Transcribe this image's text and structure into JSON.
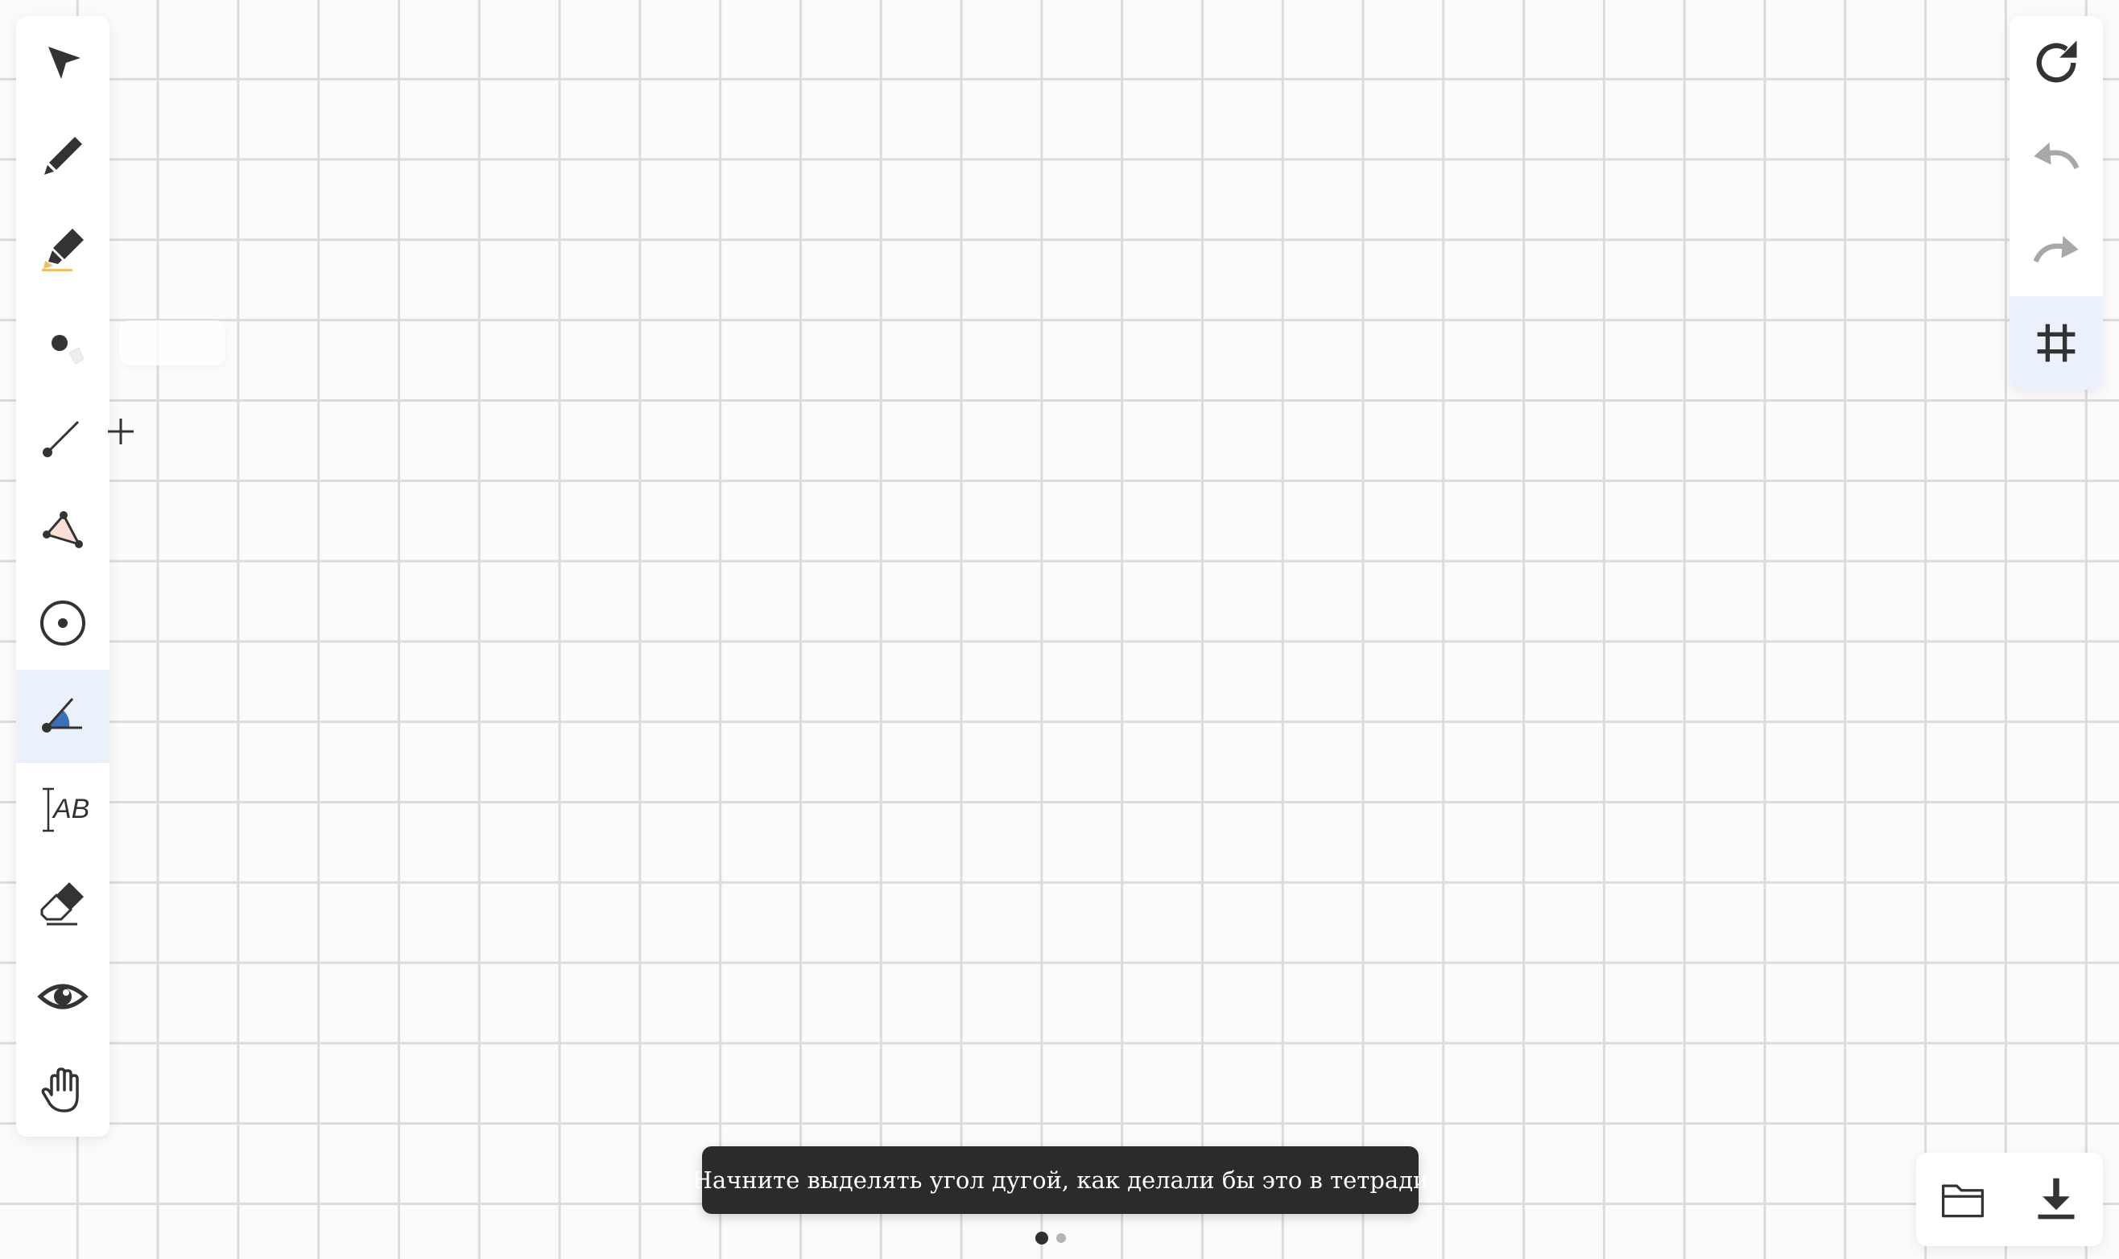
{
  "left_toolbar": {
    "tools": [
      {
        "name": "select",
        "icon": "arrow-pointer-icon"
      },
      {
        "name": "pen",
        "icon": "pencil-icon"
      },
      {
        "name": "highlighter",
        "icon": "highlighter-icon"
      },
      {
        "name": "point",
        "icon": "point-icon"
      },
      {
        "name": "segment",
        "icon": "segment-icon"
      },
      {
        "name": "polygon",
        "icon": "polygon-icon"
      },
      {
        "name": "circle",
        "icon": "circle-with-center-icon"
      },
      {
        "name": "angle",
        "icon": "angle-icon",
        "active": true
      },
      {
        "name": "text",
        "icon": "text-ab-icon",
        "label": "AB"
      },
      {
        "name": "eraser",
        "icon": "eraser-icon"
      },
      {
        "name": "visibility",
        "icon": "eye-icon"
      },
      {
        "name": "pan",
        "icon": "hand-icon"
      }
    ]
  },
  "right_toolbar": {
    "tools": [
      {
        "name": "reset",
        "icon": "refresh-icon"
      },
      {
        "name": "undo",
        "icon": "undo-icon"
      },
      {
        "name": "redo",
        "icon": "redo-icon"
      },
      {
        "name": "grid",
        "icon": "grid-hash-icon",
        "active": true
      }
    ]
  },
  "file_toolbar": {
    "tools": [
      {
        "name": "open",
        "icon": "folder-icon"
      },
      {
        "name": "download",
        "icon": "download-icon"
      }
    ]
  },
  "hint": {
    "text": "Начните выделять угол дугой, как делали бы это в тетради"
  },
  "pager": {
    "count": 2,
    "current": 1
  },
  "colors": {
    "toast_bg": "#2b2b2b",
    "active_tool_bg": "#eaf1fb",
    "angle_fill": "#3b6fb6",
    "highlighter_accent": "#f2c062",
    "polygon_fill": "#fbe0d8",
    "grid_line": "#dcdcdc",
    "icon_dark": "#333333",
    "icon_disabled": "#a8a8a8"
  }
}
